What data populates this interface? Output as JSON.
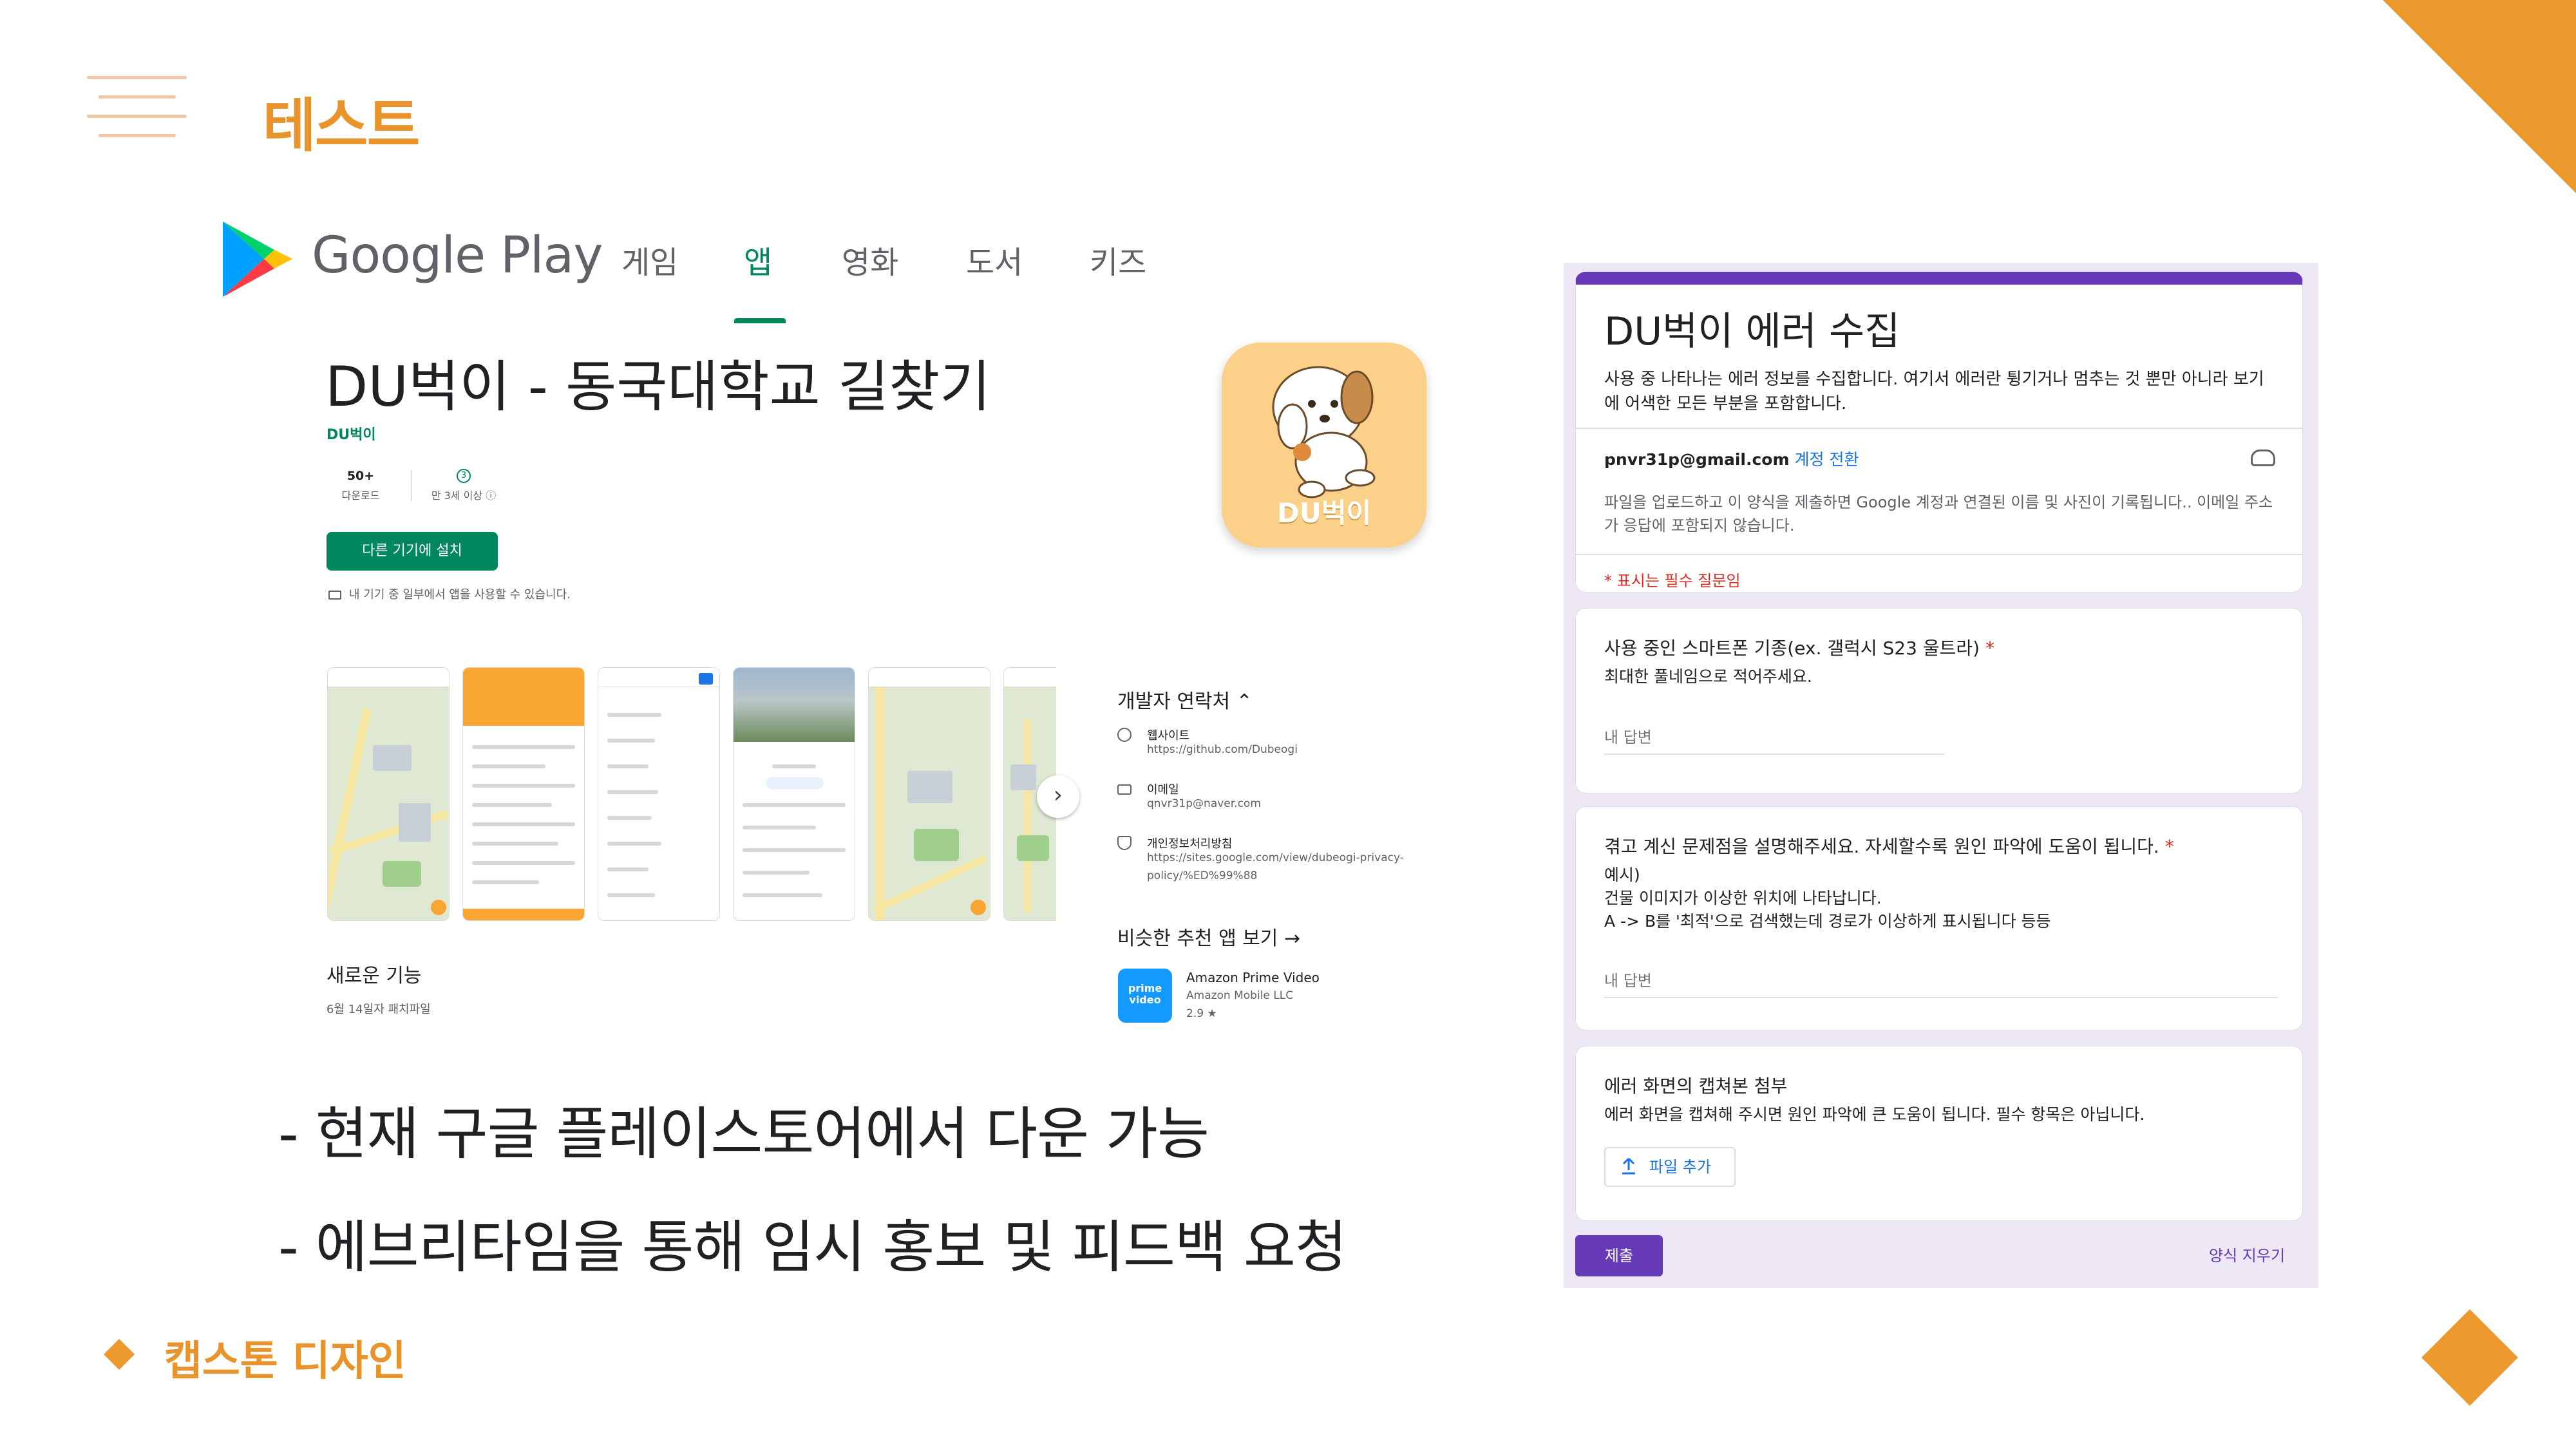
{
  "slide": {
    "title": "테스트",
    "footer": "캡스톤 디자인",
    "bullets": [
      "-  현재 구글 플레이스토어에서 다운 가능",
      "-  에브리타임을 통해 임시 홍보 및 피드백 요청"
    ],
    "accent_color": "#ec9a2e"
  },
  "play_store": {
    "logo_text": "Google Play",
    "nav": [
      "게임",
      "앱",
      "영화",
      "도서",
      "키즈"
    ],
    "active_nav": "앱",
    "app_title": "DU벅이 - 동국대학교 길찾기",
    "developer": "DU벅이",
    "downloads_value": "50+",
    "downloads_label": "다운로드",
    "rating_label": "만 3세 이상 ⓘ",
    "install_label": "다른 기기에 설치",
    "device_note": "내 기기 중 일부에서 앱을 사용할 수 있습니다.",
    "icon_label": "DU벅이",
    "whats_new": "새로운 기능",
    "whats_new_sub": "6월 14일자 패치파일",
    "dev_contact": {
      "heading": "개발자 연락처  ⌃",
      "website_label": "웹사이트",
      "website_url": "https://github.com/Dubeogi",
      "email_label": "이메일",
      "email": "qnvr31p@naver.com",
      "privacy_label": "개인정보처리방침",
      "privacy_url_1": "https://sites.google.com/view/dubeogi-privacy-",
      "privacy_url_2": "policy/%ED%99%88"
    },
    "similar": {
      "heading": "비슷한 추천 앱 보기  →",
      "app_name": "Amazon Prime Video",
      "app_dev": "Amazon Mobile LLC",
      "app_rating": "2.9 ★",
      "icon_text": "prime video"
    },
    "brand_color": "#01875f"
  },
  "form": {
    "title": "DU벅이 에러 수집",
    "description": "사용 중 나타나는 에러 정보를 수집합니다. 여기서 에러란 튕기거나 멈추는 것 뿐만 아니라 보기에 어색한 모든 부분을 포함합니다.",
    "account": "pnvr31p@gmail.com",
    "switch_account": "계정 전환",
    "account_note": "파일을 업로드하고 이 양식을 제출하면 Google 계정과 연결된 이름 및 사진이 기록됩니다.. 이메일 주소가 응답에 포함되지 않습니다.",
    "required_note": "* 표시는 필수 질문임",
    "q1_title": "사용 중인 스마트폰 기종(ex. 갤럭시 S23 울트라)",
    "q1_desc": "최대한 풀네임으로 적어주세요.",
    "q1_placeholder": "내 답변",
    "q2_title": "겪고 계신 문제점을 설명해주세요. 자세할수록 원인 파악에 도움이 됩니다.",
    "q2_desc_1": "예시)",
    "q2_desc_2": "건물 이미지가 이상한 위치에 나타납니다.",
    "q2_desc_3": "A -> B를 '최적'으로 검색했는데 경로가 이상하게 표시됩니다 등등",
    "q2_placeholder": "내 답변",
    "q3_title": "에러 화면의 캡쳐본 첨부",
    "q3_desc": "에러 화면을 캡쳐해 주시면 원인 파악에 큰 도움이 됩니다. 필수 항목은 아닙니다.",
    "upload_label": "파일 추가",
    "submit_label": "제출",
    "clear_label": "양식 지우기",
    "required_mark": "*",
    "theme_color": "#673ab7"
  }
}
